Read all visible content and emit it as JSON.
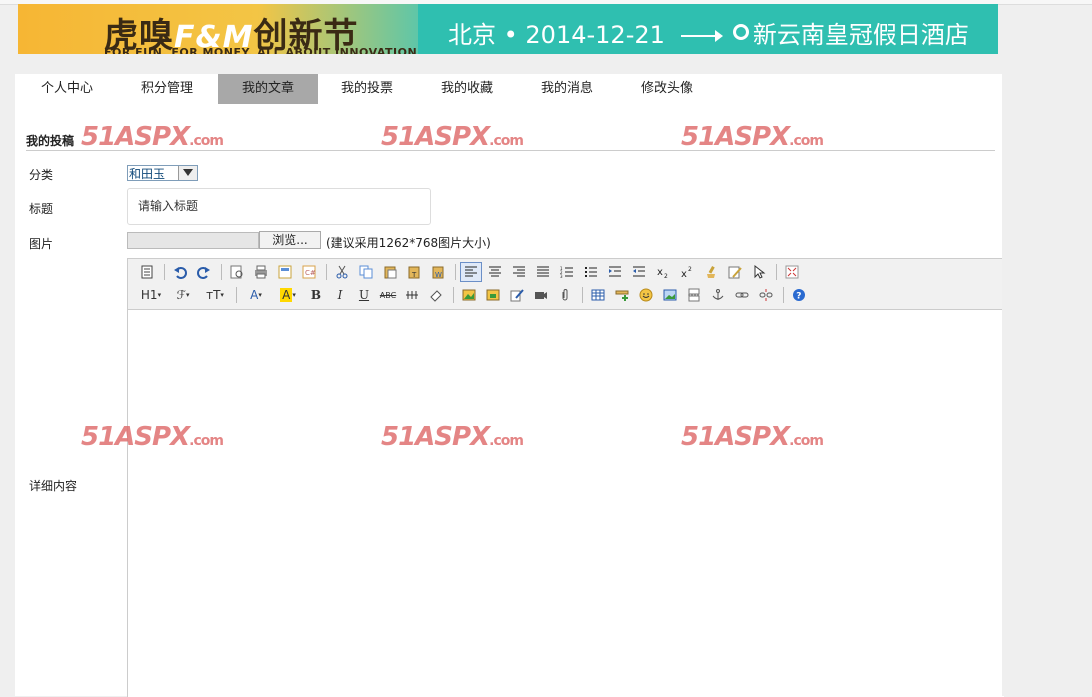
{
  "banner": {
    "logo_text": "虎嗅",
    "logo_fm": "F&M",
    "logo_suffix": "创新节",
    "slogan": "FOR FUN. FOR MONEY. ALL ABOUT INNOVATION",
    "city_date": "北京 • 2014-12-21",
    "venue": "新云南皇冠假日酒店",
    "colors": {
      "teal": "#2fbfb0",
      "yellow": "#f6b634"
    }
  },
  "tabs": [
    {
      "label": "个人中心",
      "active": false
    },
    {
      "label": "积分管理",
      "active": false
    },
    {
      "label": "我的文章",
      "active": true
    },
    {
      "label": "我的投票",
      "active": false
    },
    {
      "label": "我的收藏",
      "active": false
    },
    {
      "label": "我的消息",
      "active": false
    },
    {
      "label": "修改头像",
      "active": false
    }
  ],
  "section_title": "我的投稿",
  "form": {
    "category_label": "分类",
    "category_value": "和田玉",
    "title_label": "标题",
    "title_value": "请输入标题",
    "image_label": "图片",
    "browse_label": "浏览...",
    "image_hint": "(建议采用1262*768图片大小)",
    "content_label": "详细内容"
  },
  "toolbar": {
    "row1": [
      "source-icon",
      "undo-icon",
      "redo-icon",
      "preview-icon",
      "print-icon",
      "template-icon",
      "code-icon",
      "cut-icon",
      "copy-icon",
      "paste-icon",
      "paste-text-icon",
      "paste-word-icon",
      "align-left-icon",
      "align-center-icon",
      "align-right-icon",
      "justify-icon",
      "ordered-list-icon",
      "unordered-list-icon",
      "indent-icon",
      "outdent-icon",
      "subscript-icon",
      "superscript-icon",
      "clear-format-icon",
      "quick-format-icon",
      "select-all-icon",
      "fullscreen-icon"
    ],
    "h1_label": "H1",
    "font_label": "ℱ",
    "size_label": "тT",
    "forecolor_label": "A",
    "hilite_label": "A",
    "bold_label": "B",
    "italic_label": "I",
    "underline_label": "U",
    "strike_label": "ABC"
  },
  "watermark": {
    "text": "51ASPX",
    "suffix": ".com",
    "color": "#e07070"
  }
}
